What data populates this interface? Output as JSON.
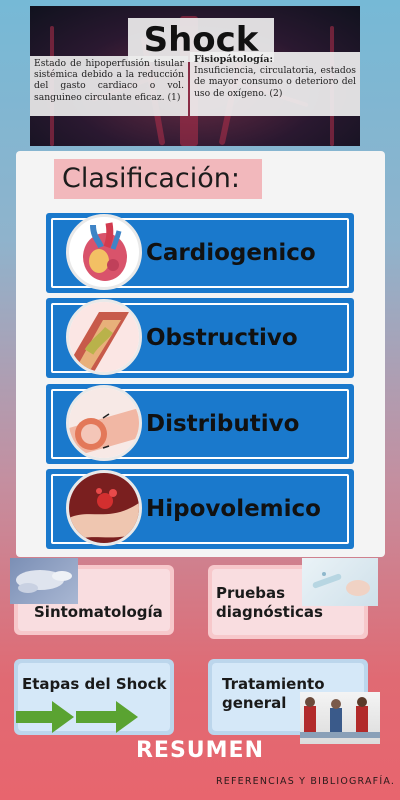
{
  "header": {
    "title": "Shock",
    "definition": "Estado de hipoperfusión tisular sistémica debido a la reducción del gasto cardiaco o vol. sanguineo circulante eficaz. (1)",
    "fisiopatologia_title": "Fisiopátología:",
    "fisiopatologia_text": "Insuficiencia, circulatoria, estados de mayor consumo o deterioro del uso de oxígeno. (2)"
  },
  "classification": {
    "title": "Clasificación:",
    "items": [
      {
        "label": "Cardiogenico",
        "icon": "heart-illustration-icon"
      },
      {
        "label": "Obstructivo",
        "icon": "obstructed-artery-icon"
      },
      {
        "label": "Distributivo",
        "icon": "dilated-vessel-icon"
      },
      {
        "label": "Hipovolemico",
        "icon": "bleeding-vessel-icon"
      }
    ]
  },
  "cards": {
    "sintomatologia": "Sintomatología",
    "pruebas": "Pruebas diagnósticas",
    "etapas": "Etapas del Shock",
    "tratamiento": "Tratamiento general"
  },
  "footer": {
    "resumen": "RESUMEN",
    "referencias": "REFERENCIAS Y BIBLIOGRAFÍA."
  },
  "colors": {
    "item_blue": "#1a79cc",
    "card_pink": "#f7c8cb",
    "card_blue": "#bcd6ec",
    "arrow_green": "#5aa331"
  }
}
